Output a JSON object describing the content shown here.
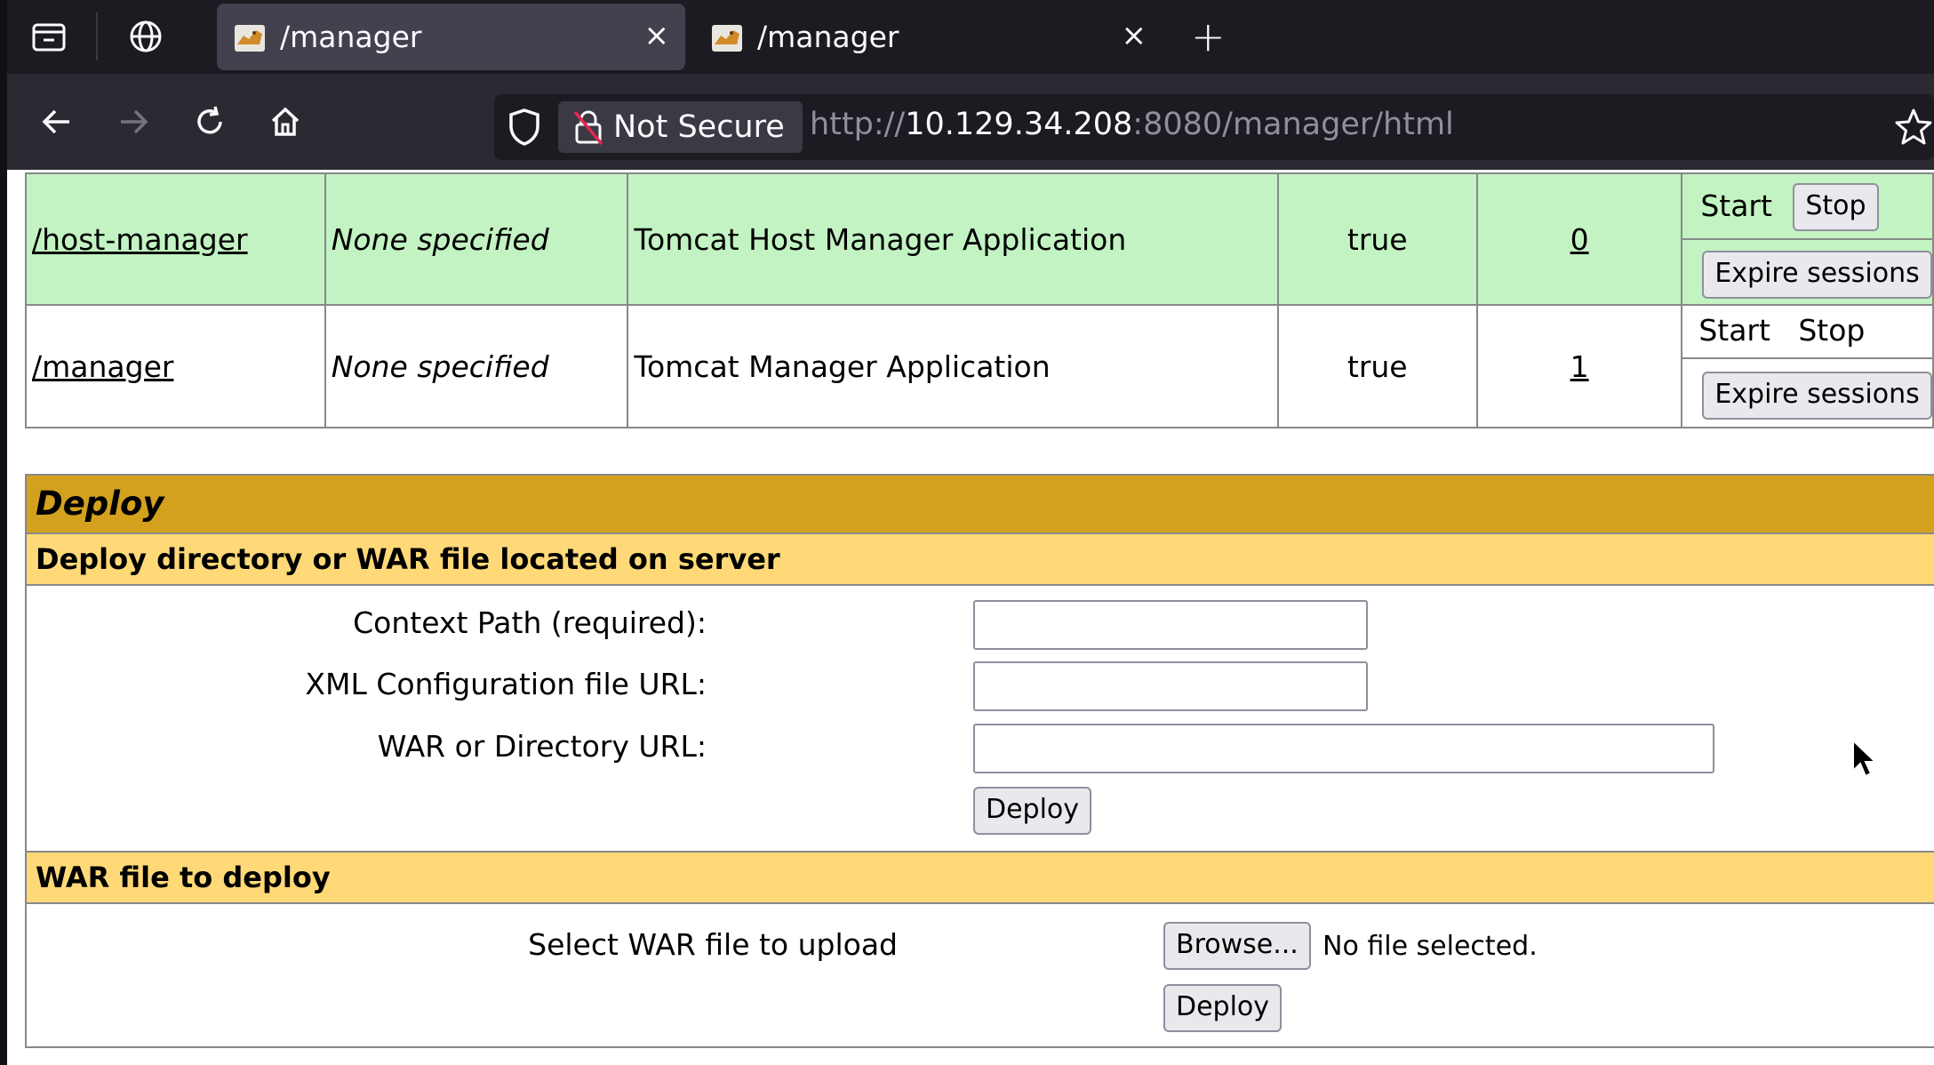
{
  "browser": {
    "tabs": [
      {
        "title": "/manager",
        "active": true,
        "close": "×"
      },
      {
        "title": "/manager",
        "active": false,
        "close": "×"
      }
    ],
    "new_tab": "+",
    "security_label": "Not Secure",
    "url": {
      "scheme": "http://",
      "host": "10.129.34.208",
      "rest": ":8080/manager/html"
    },
    "icons": [
      "tab-overview-icon",
      "globe-icon",
      "back-arrow-icon",
      "forward-arrow-icon",
      "reload-icon",
      "home-icon",
      "shield-icon",
      "insecure-lock-icon",
      "bookmark-star-icon"
    ]
  },
  "applications": {
    "rows": [
      {
        "path": "/host-manager",
        "version": "None specified",
        "display_name": "Tomcat Host Manager Application",
        "running": "true",
        "sessions": "0",
        "commands": {
          "start": "Start",
          "stop": "Stop",
          "expire": "Expire sessions"
        },
        "highlight": "#c3f3c3"
      },
      {
        "path": "/manager",
        "version": "None specified",
        "display_name": "Tomcat Manager Application",
        "running": "true",
        "sessions": "1",
        "commands": {
          "start": "Start",
          "stop": "Stop",
          "expire": "Expire sessions"
        },
        "highlight": "#ffffff"
      }
    ]
  },
  "deploy": {
    "title": "Deploy",
    "server_section": {
      "title": "Deploy directory or WAR file located on server",
      "context_path_label": "Context Path (required):",
      "xml_config_label": "XML Configuration file URL:",
      "war_url_label": "WAR or Directory URL:",
      "context_path_value": "",
      "xml_config_value": "",
      "war_url_value": "",
      "button": "Deploy"
    },
    "upload_section": {
      "title": "WAR file to deploy",
      "select_label": "Select WAR file to upload",
      "browse_button": "Browse...",
      "file_status": "No file selected.",
      "button": "Deploy"
    }
  },
  "colors": {
    "deploy_header": "#d3a11e",
    "section_header": "#ffd978",
    "running_row": "#c3f3c3"
  }
}
